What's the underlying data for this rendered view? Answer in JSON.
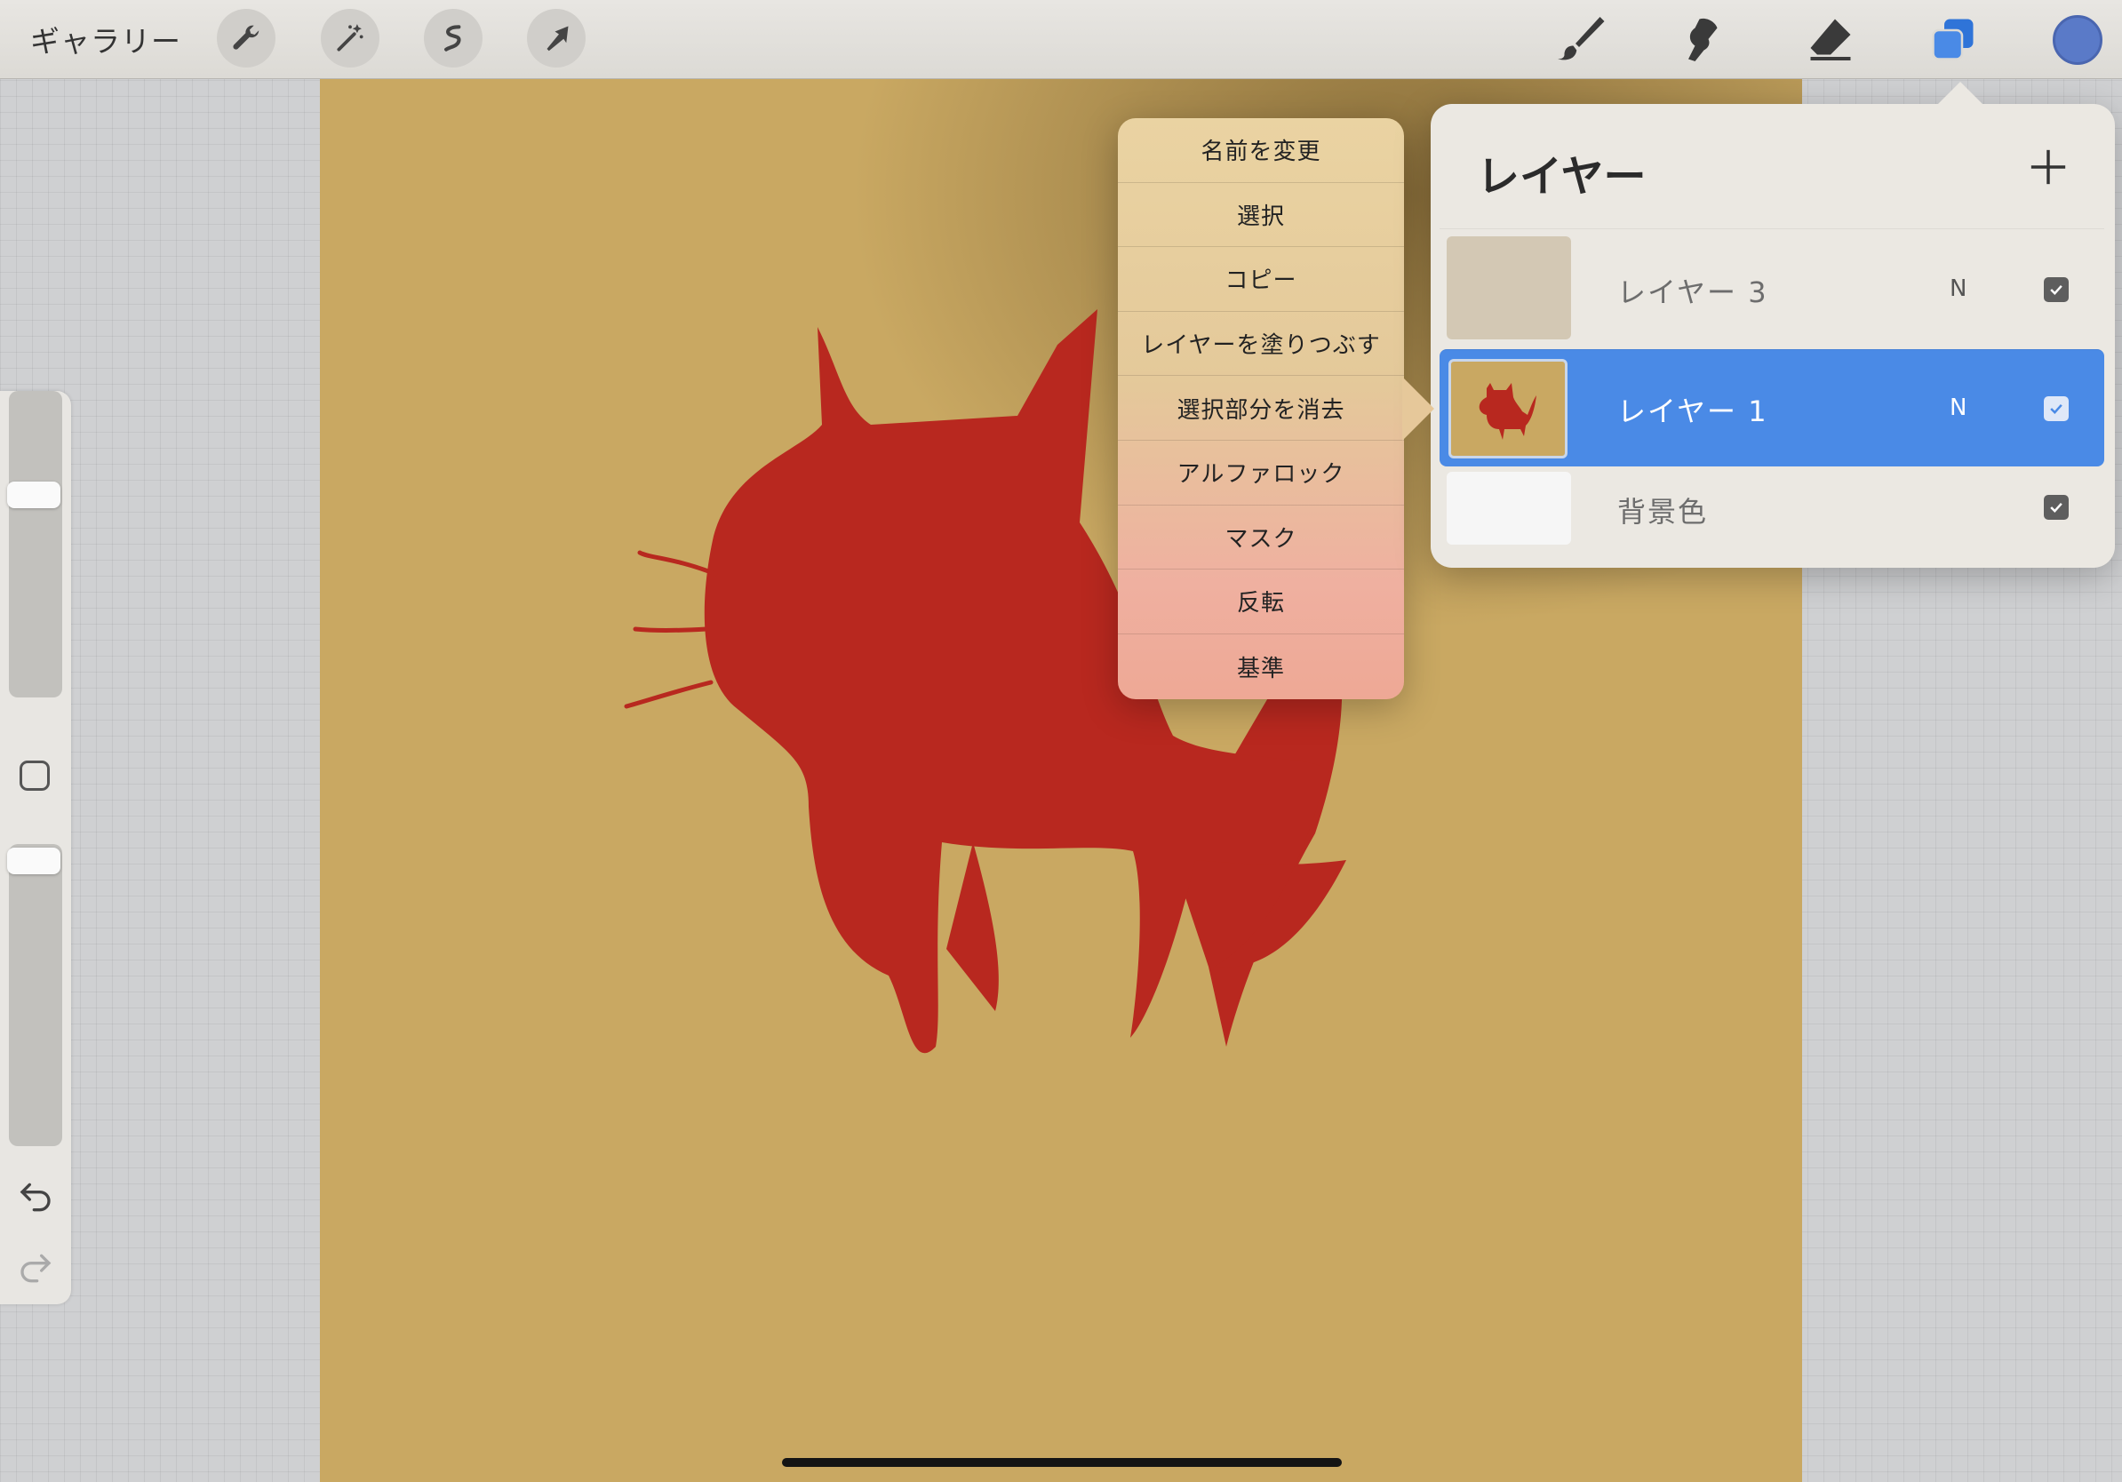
{
  "toolbar": {
    "gallery_label": "ギャラリー",
    "left_tools": [
      "wrench-icon",
      "magic-wand-icon",
      "selection-icon",
      "transform-arrow-icon"
    ],
    "right_tools": [
      "brush-icon",
      "smudge-icon",
      "eraser-icon",
      "layers-icon"
    ],
    "current_color": "#5a7ac8"
  },
  "context_menu": {
    "items": [
      "名前を変更",
      "選択",
      "コピー",
      "レイヤーを塗りつぶす",
      "選択部分を消去",
      "アルファロック",
      "マスク",
      "反転",
      "基準"
    ]
  },
  "layers_panel": {
    "title": "レイヤー",
    "layers": [
      {
        "name": "レイヤー 3",
        "blend": "N",
        "visible": true,
        "active": false
      },
      {
        "name": "レイヤー 1",
        "blend": "N",
        "visible": true,
        "active": true
      },
      {
        "name": "背景色",
        "blend": "",
        "visible": true,
        "active": false
      }
    ]
  },
  "sidebar": {
    "brush_size": 0.75,
    "opacity": 0.95
  },
  "colors": {
    "canvas": "#c9a862",
    "cat": "#b8281f",
    "active_layer": "#4a8ae6"
  }
}
